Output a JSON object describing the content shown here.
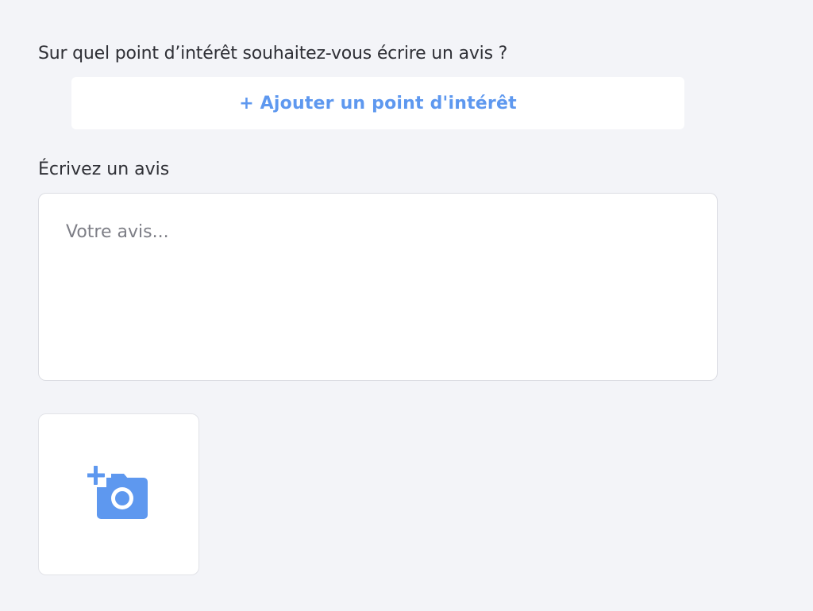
{
  "form": {
    "poi_question": "Sur quel point d’intérêt souhaitez-vous écrire un avis ?",
    "add_poi_label": "+ Ajouter un point d'intérêt",
    "review_label": "Écrivez un avis",
    "review_placeholder": "Votre avis...",
    "review_value": ""
  },
  "photo_upload": {
    "icon": "add-photo-camera-icon"
  },
  "colors": {
    "background": "#f3f4f8",
    "accent": "#5e98ef",
    "text": "#2f3036",
    "placeholder": "#7d7e86"
  }
}
